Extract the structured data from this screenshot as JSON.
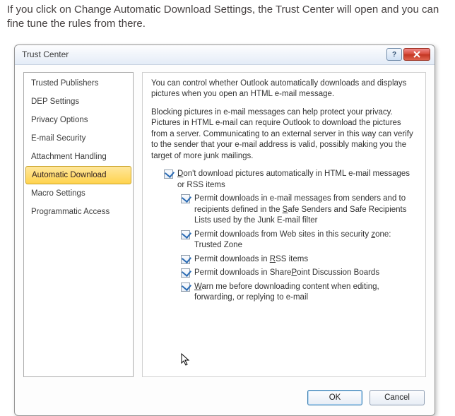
{
  "intro": "If you click on Change Automatic Download Settings, the Trust Center will open and you can fine tune the rules from there.",
  "dialog": {
    "title": "Trust Center",
    "sidebar": [
      {
        "label": "Trusted Publishers",
        "selected": false
      },
      {
        "label": "DEP Settings",
        "selected": false
      },
      {
        "label": "Privacy Options",
        "selected": false
      },
      {
        "label": "E-mail Security",
        "selected": false
      },
      {
        "label": "Attachment Handling",
        "selected": false
      },
      {
        "label": "Automatic Download",
        "selected": true
      },
      {
        "label": "Macro Settings",
        "selected": false
      },
      {
        "label": "Programmatic Access",
        "selected": false
      }
    ],
    "content": {
      "para1": "You can control whether Outlook automatically downloads and displays pictures when you open an HTML e-mail message.",
      "para2": "Blocking pictures in e-mail messages can help protect your privacy. Pictures in HTML e-mail can require Outlook to download the pictures from a server. Communicating to an external server in this way can verify to the sender that your e-mail address is valid, possibly making you the target of more junk mailings.",
      "checks": {
        "main": {
          "checked": true,
          "pre": "",
          "ul": "D",
          "post": "on't download pictures automatically in HTML e-mail messages or RSS items"
        },
        "sub1": {
          "checked": true,
          "pre": "Permit downloads in e-mail messages from senders and to recipients defined in the ",
          "ul": "S",
          "post": "afe Senders and Safe Recipients Lists used by the Junk E-mail filter"
        },
        "sub2": {
          "checked": true,
          "pre": "Permit downloads from Web sites in this security ",
          "ul": "z",
          "post": "one: Trusted Zone"
        },
        "sub3": {
          "checked": true,
          "pre": "Permit downloads in ",
          "ul": "R",
          "post": "SS items"
        },
        "sub4": {
          "checked": true,
          "pre": "Permit downloads in Share",
          "ul": "P",
          "post": "oint Discussion Boards"
        },
        "sub5": {
          "checked": true,
          "pre": "",
          "ul": "W",
          "post": "arn me before downloading content when editing, forwarding, or replying to e-mail"
        }
      }
    },
    "buttons": {
      "ok": "OK",
      "cancel": "Cancel"
    }
  }
}
